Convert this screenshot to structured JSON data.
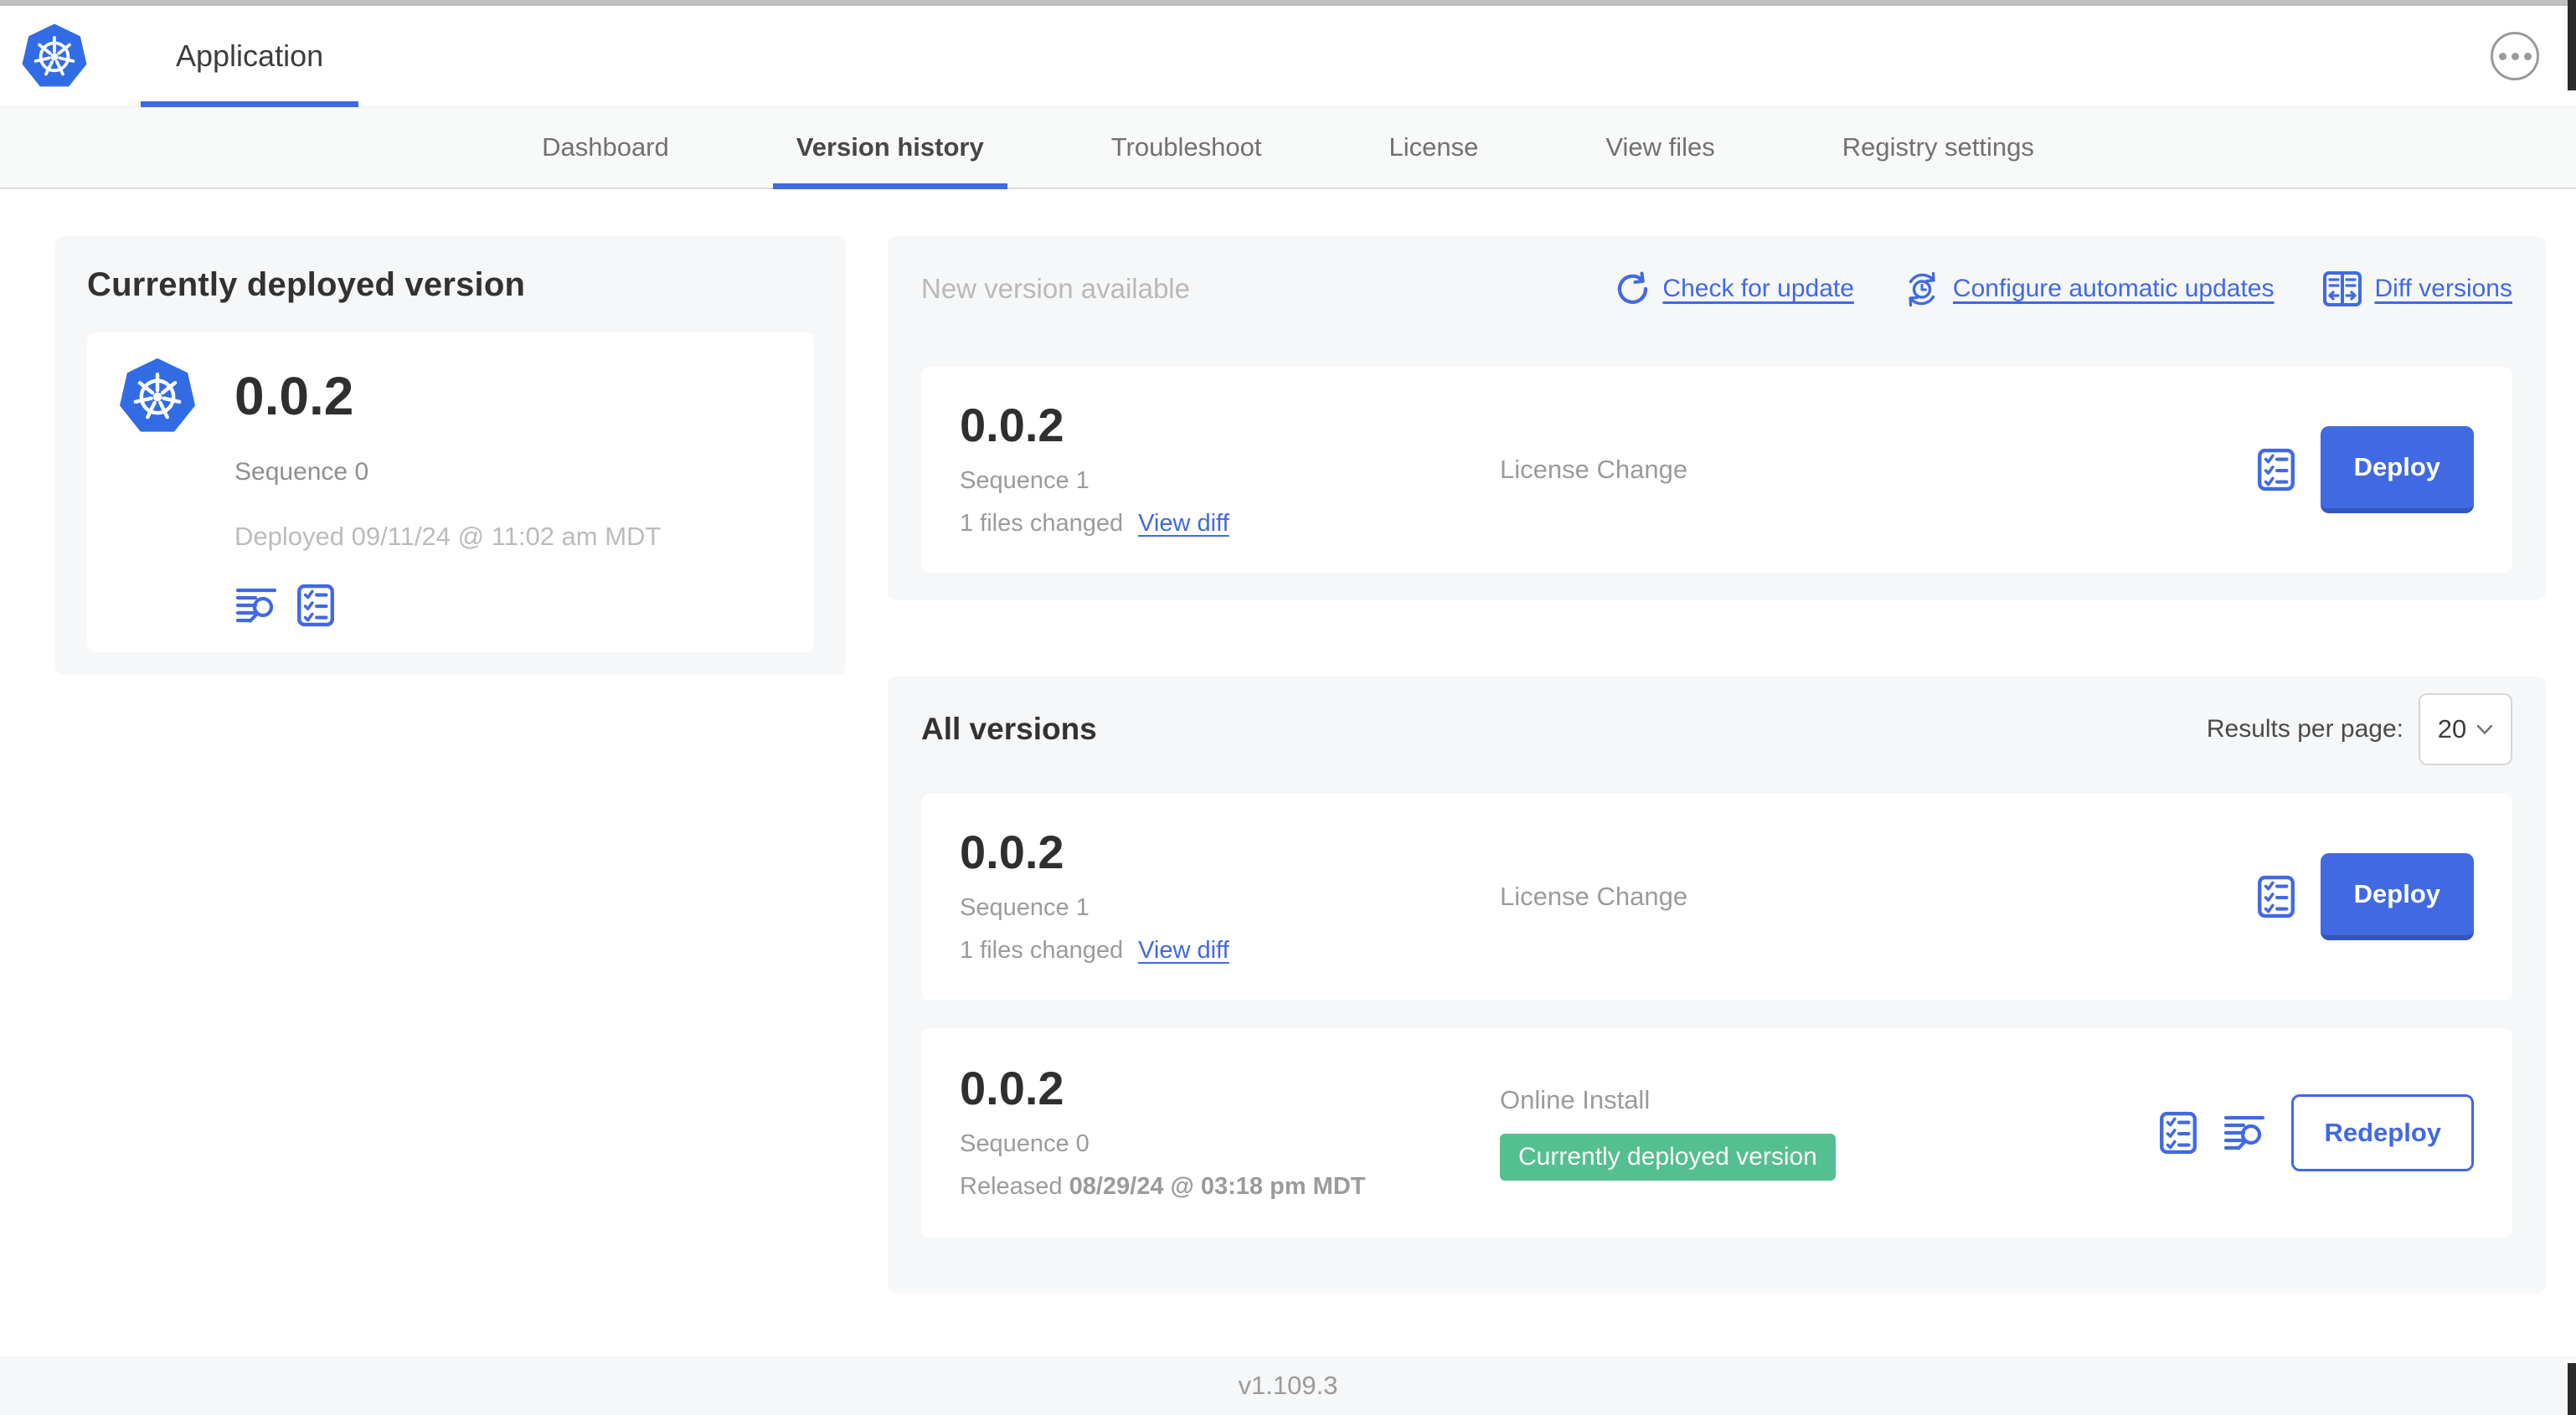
{
  "header": {
    "app_title": "Application"
  },
  "nav": {
    "tabs": [
      {
        "label": "Dashboard"
      },
      {
        "label": "Version history"
      },
      {
        "label": "Troubleshoot"
      },
      {
        "label": "License"
      },
      {
        "label": "View files"
      },
      {
        "label": "Registry settings"
      }
    ],
    "active_tab": "Version history"
  },
  "current_version_panel": {
    "title": "Currently deployed version",
    "version": "0.0.2",
    "sequence": "Sequence 0",
    "deployed_timestamp": "Deployed 09/11/24 @ 11:02 am MDT"
  },
  "new_version_section": {
    "title": "New version available",
    "actions": [
      {
        "label": "Check for update"
      },
      {
        "label": "Configure automatic updates"
      },
      {
        "label": "Diff versions"
      }
    ],
    "row": {
      "version": "0.0.2",
      "sequence": "Sequence 1",
      "files_changed": "1 files changed",
      "view_diff_label": "View diff",
      "source": "License Change",
      "deploy_label": "Deploy"
    }
  },
  "all_versions_section": {
    "title": "All versions",
    "results_per_page": {
      "label": "Results per page:",
      "value": "20"
    },
    "rows": [
      {
        "version": "0.0.2",
        "sequence": "Sequence 1",
        "files_changed": "1 files changed",
        "view_diff_label": "View diff",
        "source": "License Change",
        "action_label": "Deploy"
      },
      {
        "version": "0.0.2",
        "sequence": "Sequence 0",
        "released_label": "Released",
        "released_date": "08/29/24 @ 03:18 pm MDT",
        "source": "Online Install",
        "badge": "Currently deployed version",
        "action_label": "Redeploy"
      }
    ]
  },
  "footer": {
    "app_manager_version": "v1.109.3"
  },
  "colors": {
    "accent_blue": "#4169E1",
    "kubernetes_blue": "#326CE5",
    "success_green": "#54BF90",
    "section_background": "#F5F7F8"
  }
}
